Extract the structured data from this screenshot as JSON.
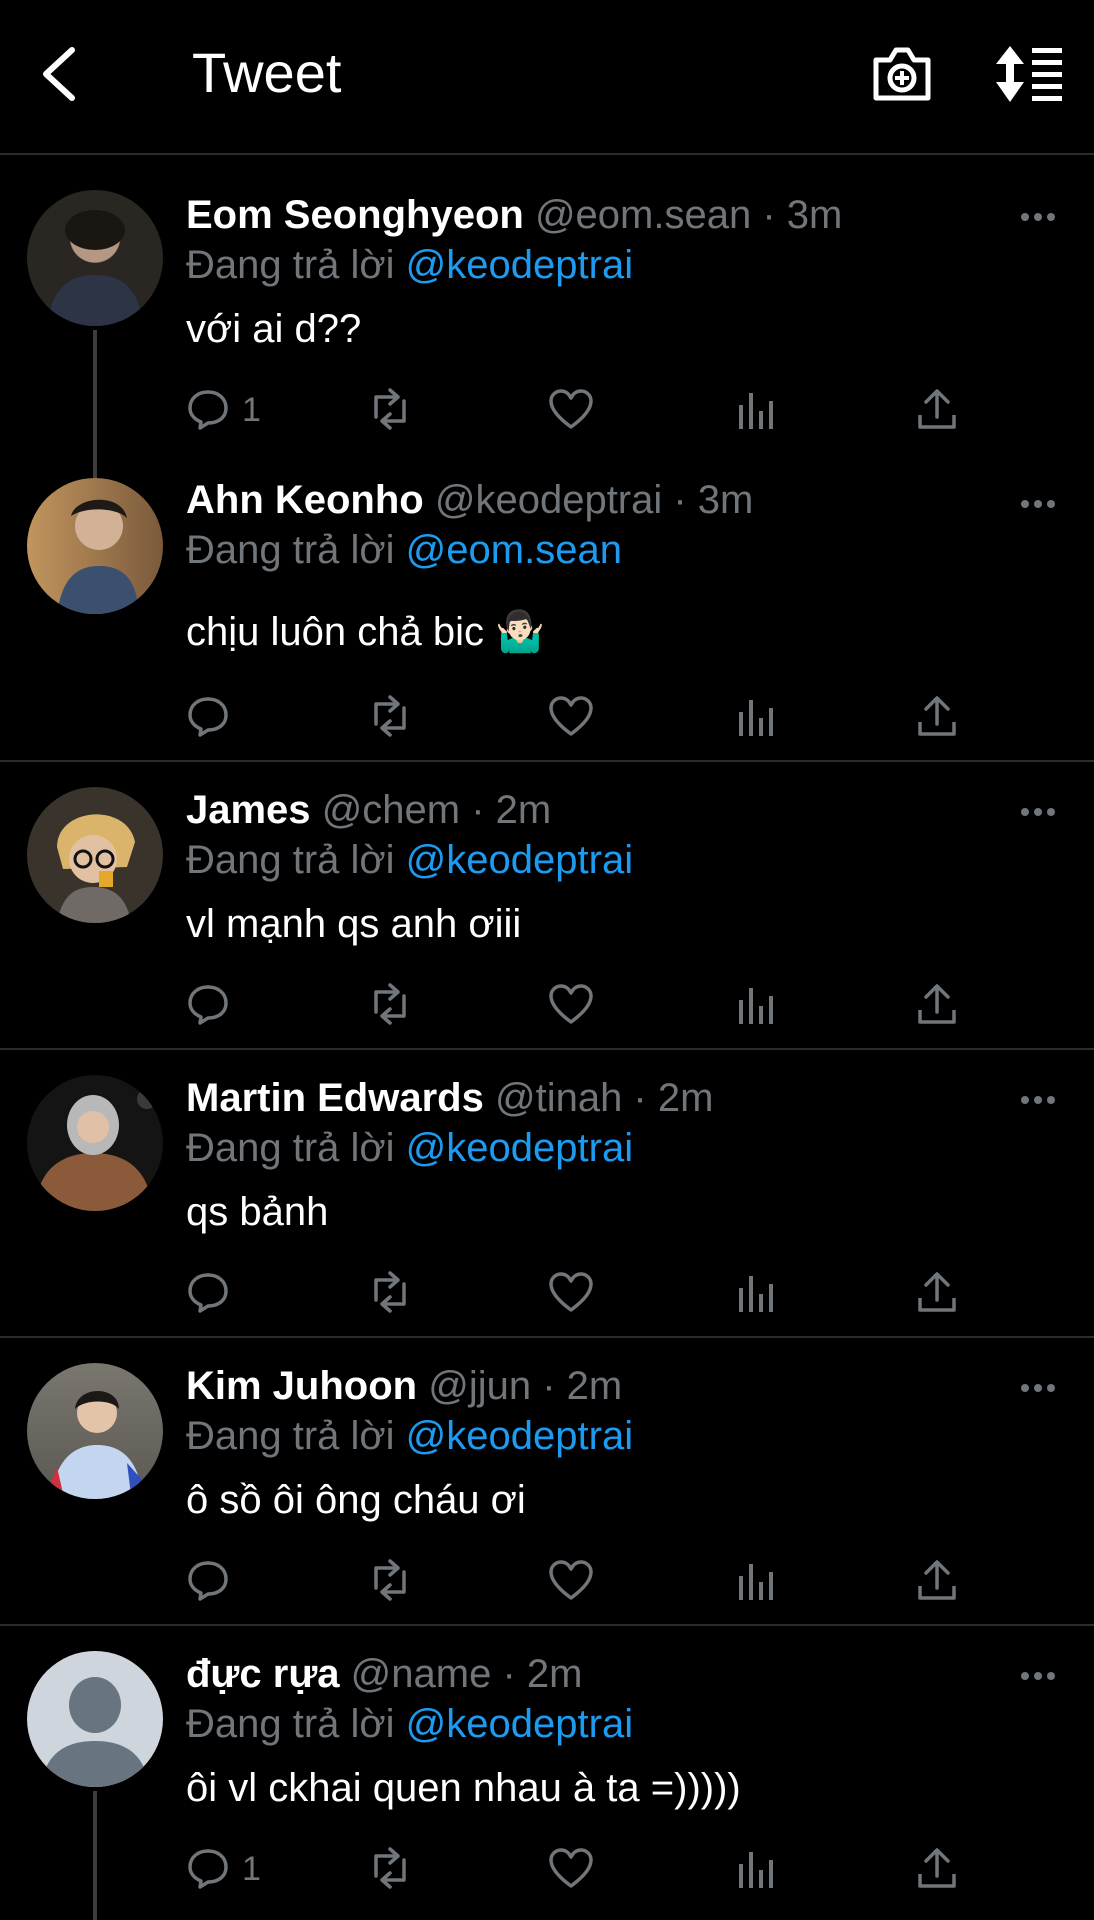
{
  "header": {
    "title": "Tweet",
    "back_icon": "back-arrow-icon",
    "camera_icon": "camera-plus-icon",
    "sort_icon": "sort-icon"
  },
  "reply_prefix": "Đang trả lời",
  "tweets": [
    {
      "name": "Eom Seonghyeon",
      "meta": "@eom.sean · 3m",
      "reply_to": "@keodeptrai",
      "text": "với ai d??",
      "reply_count": "1"
    },
    {
      "name": "Ahn Keonho",
      "meta": "@keodeptrai · 3m",
      "reply_to": "@eom.sean",
      "text": "chịu luôn chả bic 🤷🏻‍♂️",
      "reply_count": ""
    },
    {
      "name": "James",
      "meta": "@chem · 2m",
      "reply_to": "@keodeptrai",
      "text": "vl mạnh qs anh ơiii",
      "reply_count": ""
    },
    {
      "name": "Martin Edwards",
      "meta": "@tinah · 2m",
      "reply_to": "@keodeptrai",
      "text": "qs bảnh",
      "reply_count": ""
    },
    {
      "name": "Kim Juhoon",
      "meta": "@jjun · 2m",
      "reply_to": "@keodeptrai",
      "text": "ô sồ ôi ông cháu ơi",
      "reply_count": ""
    },
    {
      "name": "đực rựa",
      "meta": "@name · 2m",
      "reply_to": "@keodeptrai",
      "text": "ôi vl ckhai quen nhau à ta =)))))",
      "reply_count": "1"
    }
  ],
  "colors": {
    "background": "#000000",
    "accent": "#1d9bf0",
    "muted": "#71767b",
    "divider": "#2a2d30"
  }
}
